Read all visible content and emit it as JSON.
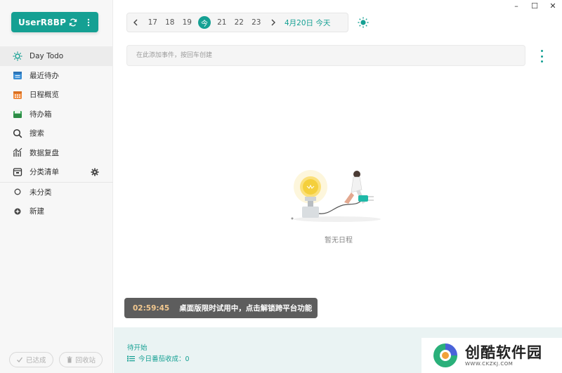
{
  "window": {
    "minimize": "–",
    "maximize": "☐",
    "close": "✕"
  },
  "user": {
    "name": "UserR8BP"
  },
  "sidebar": {
    "items": [
      {
        "label": "Day Todo",
        "icon": "sun-icon"
      },
      {
        "label": "最近待办",
        "icon": "calendar-list-icon"
      },
      {
        "label": "日程概览",
        "icon": "calendar-grid-icon"
      },
      {
        "label": "待办箱",
        "icon": "inbox-icon"
      },
      {
        "label": "搜索",
        "icon": "search-icon"
      },
      {
        "label": "数据复盘",
        "icon": "chart-icon"
      },
      {
        "label": "分类清单",
        "icon": "folder-icon"
      }
    ],
    "categories": [
      {
        "label": "未分类",
        "icon": "circle-icon"
      },
      {
        "label": "新建",
        "icon": "plus-circle-icon"
      }
    ],
    "bottom": {
      "done": "已达成",
      "trash": "回收站"
    }
  },
  "datebar": {
    "days": [
      "17",
      "18",
      "19",
      "今",
      "21",
      "22",
      "23"
    ],
    "today_label": "4月20日 今天"
  },
  "add_input": {
    "placeholder": "在此添加事件，按回车创建"
  },
  "empty": {
    "text": "暂无日程"
  },
  "toast": {
    "time": "02:59:45",
    "message": "桌面版限时试用中，点击解锁跨平台功能"
  },
  "footer": {
    "status": "待开始",
    "harvest": "今日番茄收成：0"
  },
  "watermark": {
    "title": "创酷软件园",
    "url": "WWW.CKZKJ.COM"
  },
  "colors": {
    "accent": "#15a093",
    "toast_bg": "#5d5d5d",
    "toast_time": "#f2c88f"
  }
}
